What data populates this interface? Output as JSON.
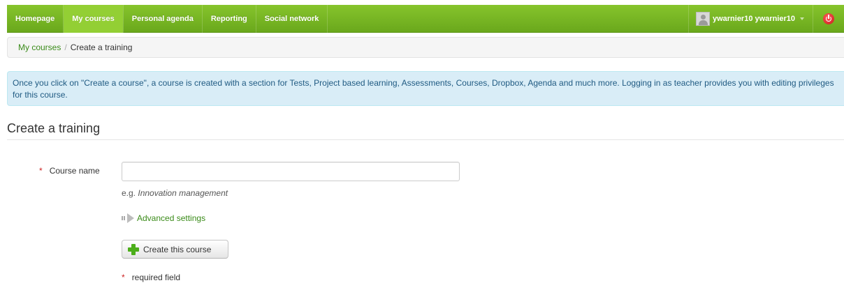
{
  "nav": {
    "items": [
      {
        "label": "Homepage",
        "active": false
      },
      {
        "label": "My courses",
        "active": true
      },
      {
        "label": "Personal agenda",
        "active": false
      },
      {
        "label": "Reporting",
        "active": false
      },
      {
        "label": "Social network",
        "active": false
      }
    ],
    "user_name": "ywarnier10 ywarnier10",
    "colors": {
      "bar": "#78b823",
      "active": "#93cf34",
      "logout": "#d22222"
    }
  },
  "breadcrumb": {
    "parent": "My courses",
    "separator": "/",
    "current": "Create a training"
  },
  "alert": {
    "text": "Once you click on \"Create a course\", a course is created with a section for Tests, Project based learning, Assessments, Courses, Dropbox, Agenda and much more. Logging in as teacher provides you with editing privileges for this course."
  },
  "page": {
    "title": "Create a training"
  },
  "form": {
    "required_mark": "*",
    "course_name_label": "Course name",
    "course_name_value": "",
    "course_name_placeholder": "",
    "help_prefix": "e.g.",
    "help_example": "Innovation management",
    "advanced_label": "Advanced settings",
    "submit_label": "Create this course",
    "required_note": "required field"
  },
  "icons": {
    "avatar": "user-avatar-icon",
    "dropdown": "caret-down-icon",
    "logout": "power-icon",
    "advanced": "arrow-right-icon",
    "submit": "plus-icon"
  }
}
